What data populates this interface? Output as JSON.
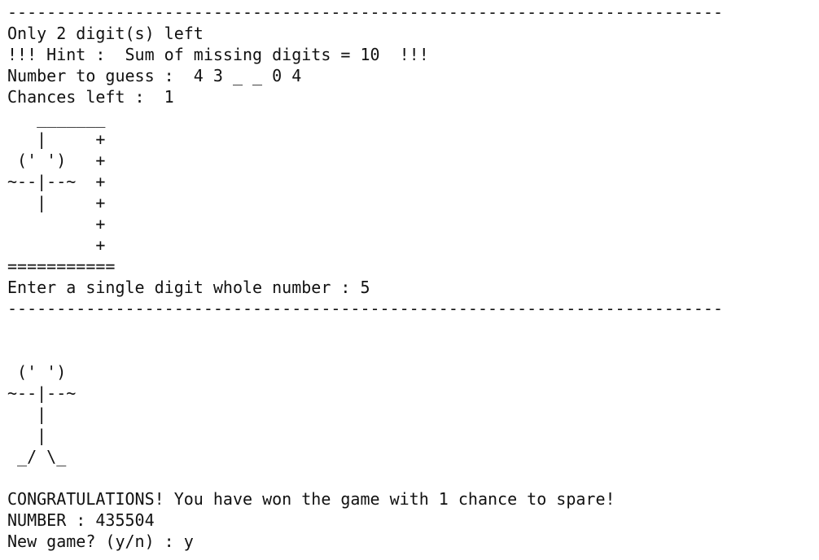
{
  "terminal": {
    "lines": [
      "-------------------------------------------------------------------------",
      "Only 2 digit(s) left",
      "!!! Hint :  Sum of missing digits = 10  !!!",
      "Number to guess :  4 3 _ _ 0 4",
      "Chances left :  1",
      "   _______",
      "   |     +",
      " (' ')   +",
      "~--|--~  +",
      "   |     +",
      "         +",
      "         +",
      "===========",
      "Enter a single digit whole number : 5",
      "-------------------------------------------------------------------------",
      "",
      "",
      " (' ')",
      "~--|--~",
      "   |",
      "   |",
      " _/ \\_",
      "",
      "CONGRATULATIONS! You have won the game with 1 chance to spare!",
      "NUMBER : 435504",
      "New game? (y/n) : y"
    ]
  }
}
